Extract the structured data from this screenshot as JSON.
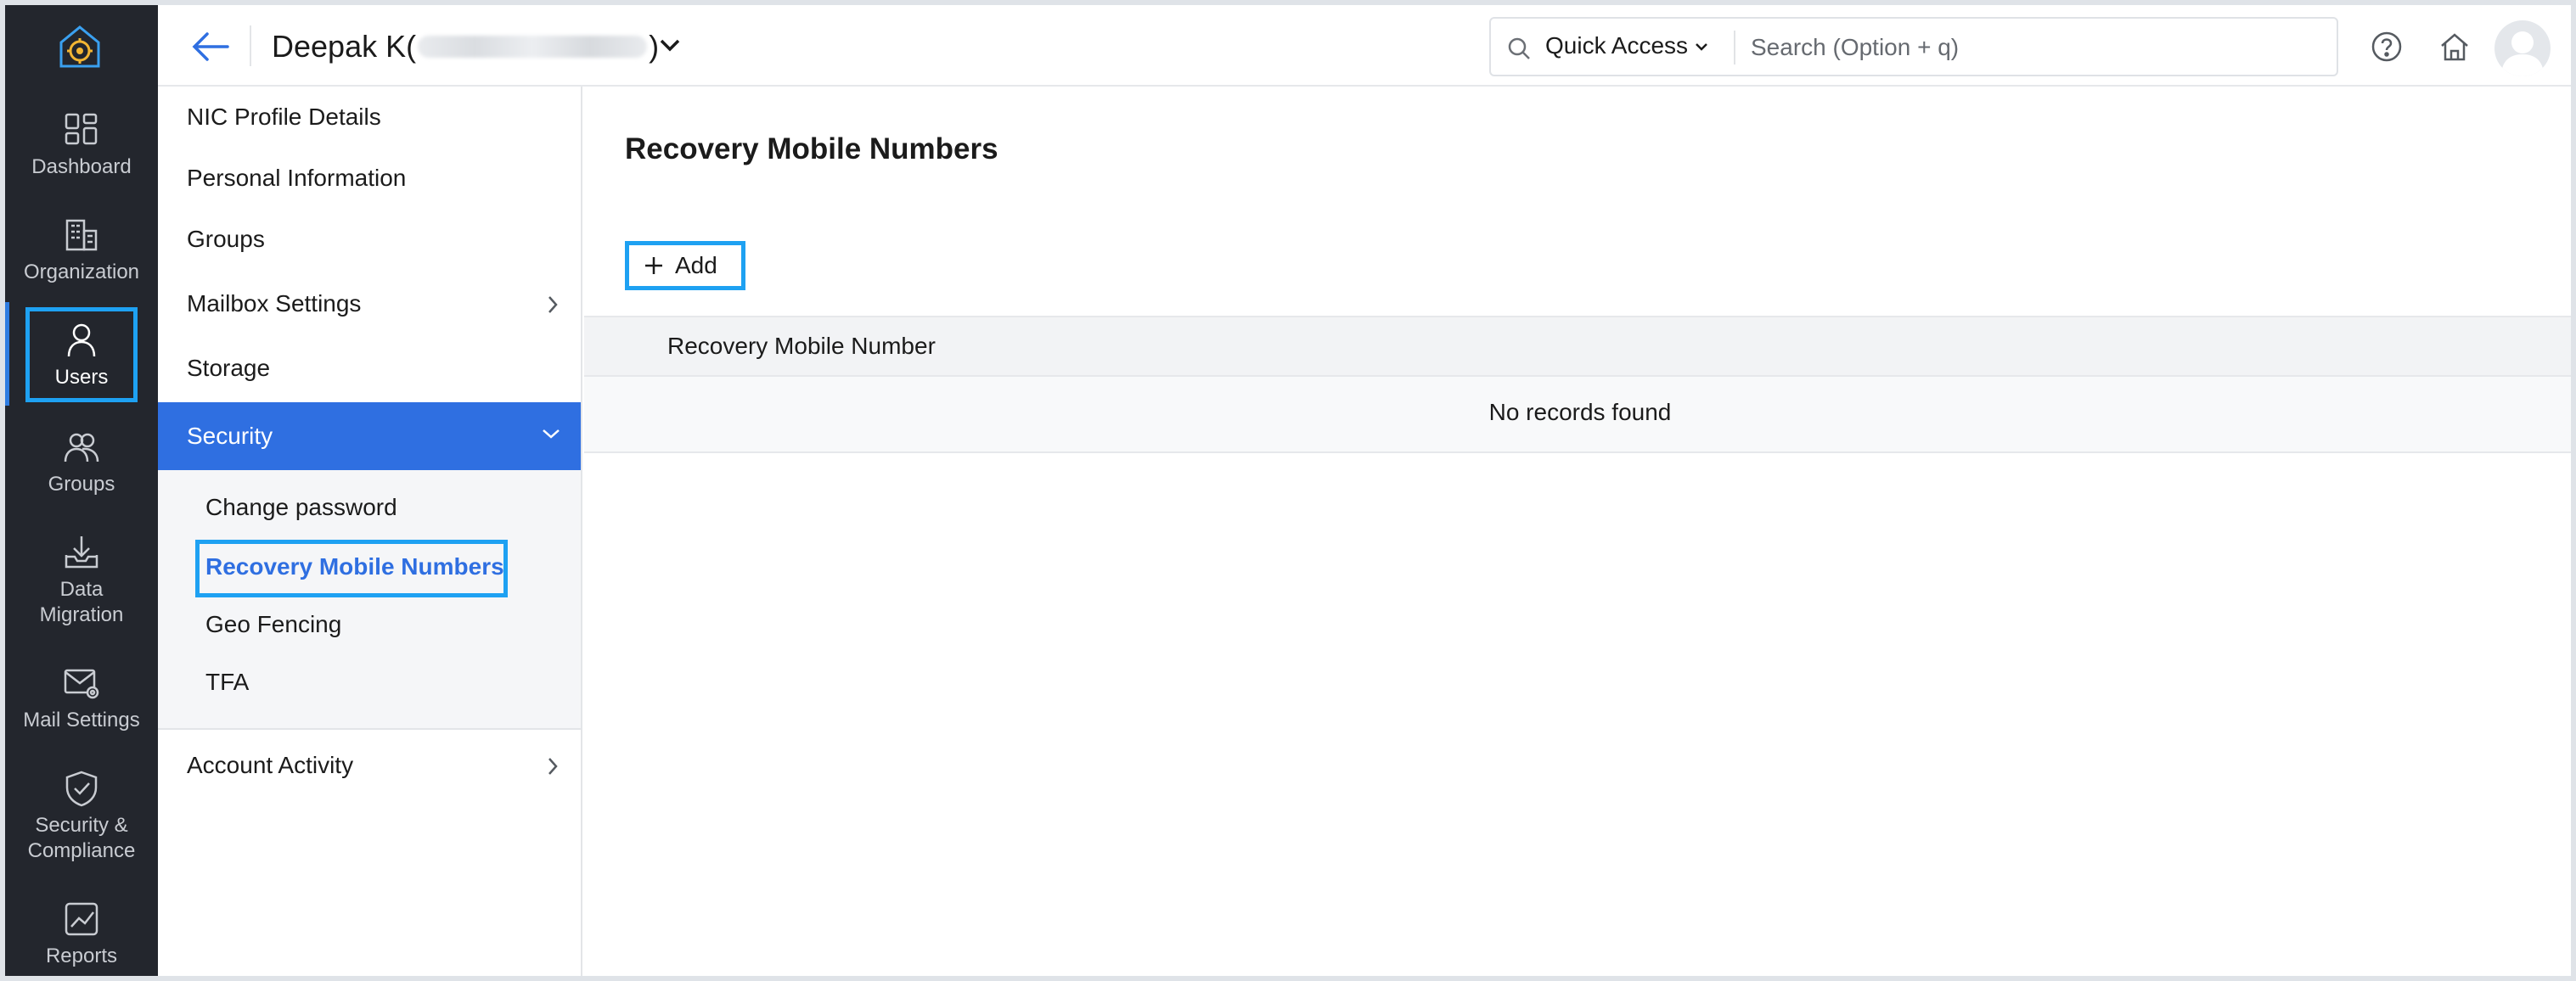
{
  "rail": {
    "items": [
      {
        "label": "Dashboard",
        "icon": "dashboard-icon"
      },
      {
        "label": "Organization",
        "icon": "organization-icon"
      },
      {
        "label": "Users",
        "icon": "user-icon"
      },
      {
        "label": "Groups",
        "icon": "groups-icon"
      },
      {
        "label": "Data",
        "label2": "Migration",
        "icon": "data-migration-icon"
      },
      {
        "label": "Mail Settings",
        "icon": "mail-settings-icon"
      },
      {
        "label": "Security &",
        "label2": "Compliance",
        "icon": "shield-check-icon"
      },
      {
        "label": "Reports",
        "icon": "reports-icon"
      }
    ],
    "active": "Users",
    "accent": "#1ea1f2",
    "logo_color": "#f2b533"
  },
  "header": {
    "user_name_prefix": "Deepak K(",
    "user_name_suffix": ")",
    "quick_access": "Quick Access",
    "search_placeholder": "Search (Option + q)"
  },
  "subnav": {
    "items": [
      "NIC Profile Details",
      "Personal Information",
      "Groups",
      "Mailbox Settings",
      "Storage",
      "Security",
      "Account Activity"
    ],
    "active": "Security",
    "security_subitems": [
      "Change password",
      "Recovery Mobile Numbers",
      "Geo Fencing",
      "TFA"
    ],
    "selected_subitem": "Recovery Mobile Numbers",
    "active_color": "#2f6fe1"
  },
  "main": {
    "title": "Recovery Mobile Numbers",
    "add_label": "Add",
    "table": {
      "columns": [
        "Recovery Mobile Number"
      ],
      "empty_message": "No records found"
    }
  }
}
